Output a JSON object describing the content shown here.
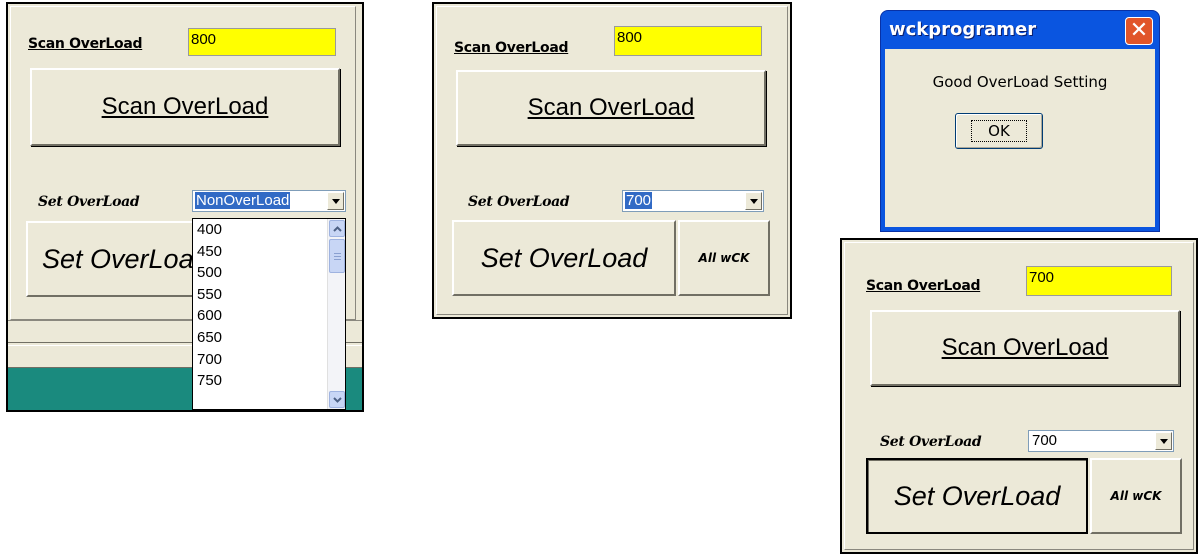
{
  "panel1": {
    "scan_label": "Scan OverLoad",
    "scan_value": "800",
    "scan_button": "Scan OverLoad",
    "set_label": "Set OverLoad",
    "combo_value": "NonOverLoad",
    "set_button": "Set OverLoad",
    "dropdown_items": [
      "400",
      "450",
      "500",
      "550",
      "600",
      "650",
      "700",
      "750"
    ]
  },
  "panel2": {
    "scan_label": "Scan OverLoad",
    "scan_value": "800",
    "scan_button": "Scan OverLoad",
    "set_label": "Set OverLoad",
    "combo_value": "700",
    "set_button": "Set OverLoad",
    "all_button": "All wCK"
  },
  "dialog": {
    "title": "wckprogramer",
    "message": "Good OverLoad Setting",
    "ok_label": "OK",
    "close_glyph": "✕"
  },
  "panel3": {
    "scan_label": "Scan OverLoad",
    "scan_value": "700",
    "scan_button": "Scan OverLoad",
    "set_label": "Set OverLoad",
    "combo_value": "700",
    "set_button": "Set OverLoad",
    "all_button": "All wCK"
  },
  "colors": {
    "panel_bg": "#ece9d8",
    "highlight_yellow": "#ffff00",
    "selection_blue": "#316ac5",
    "xp_title_blue": "#0a55e0",
    "close_red": "#e1552a",
    "taskbar_teal": "#1a8a7e"
  },
  "icons": [
    "dropdown-arrow-icon",
    "scroll-up-icon",
    "scroll-down-icon",
    "close-icon"
  ]
}
